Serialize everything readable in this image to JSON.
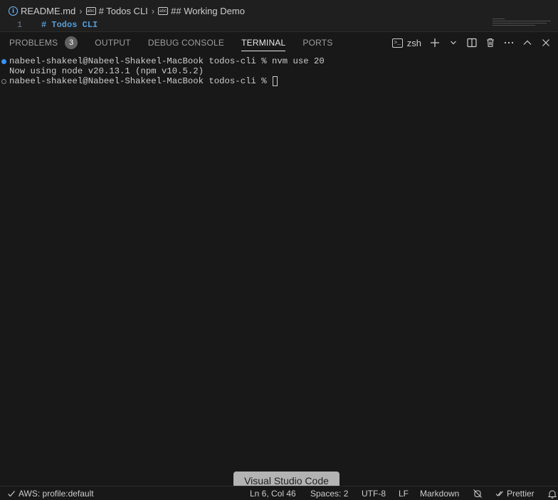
{
  "breadcrumb": {
    "file": "README.md",
    "heading1": "# Todos CLI",
    "heading2": "## Working Demo",
    "abc_glyph": "abc"
  },
  "editor": {
    "line_number": "1",
    "line_text": "# Todos CLI"
  },
  "panel": {
    "tabs": [
      {
        "label": "PROBLEMS",
        "badge": "3"
      },
      {
        "label": "OUTPUT"
      },
      {
        "label": "DEBUG CONSOLE"
      },
      {
        "label": "TERMINAL",
        "active": true
      },
      {
        "label": "PORTS"
      }
    ],
    "shell": "zsh",
    "actions": [
      "new-terminal",
      "launch-profile",
      "split",
      "kill",
      "more",
      "maximize",
      "close"
    ]
  },
  "terminal": {
    "lines": [
      "nabeel-shakeel@Nabeel-Shakeel-MacBook todos-cli % nvm use 20",
      "Now using node v20.13.1 (npm v10.5.2)",
      "nabeel-shakeel@Nabeel-Shakeel-MacBook todos-cli % "
    ]
  },
  "tooltip": "Visual Studio Code",
  "statusbar": {
    "aws": "AWS: profile:default",
    "position": "Ln 6, Col 46",
    "spaces": "Spaces: 2",
    "encoding": "UTF-8",
    "eol": "LF",
    "language": "Markdown",
    "prettier": "Prettier"
  },
  "colors": {
    "background": "#181818",
    "accent": "#3794ff",
    "heading": "#569cd6"
  }
}
